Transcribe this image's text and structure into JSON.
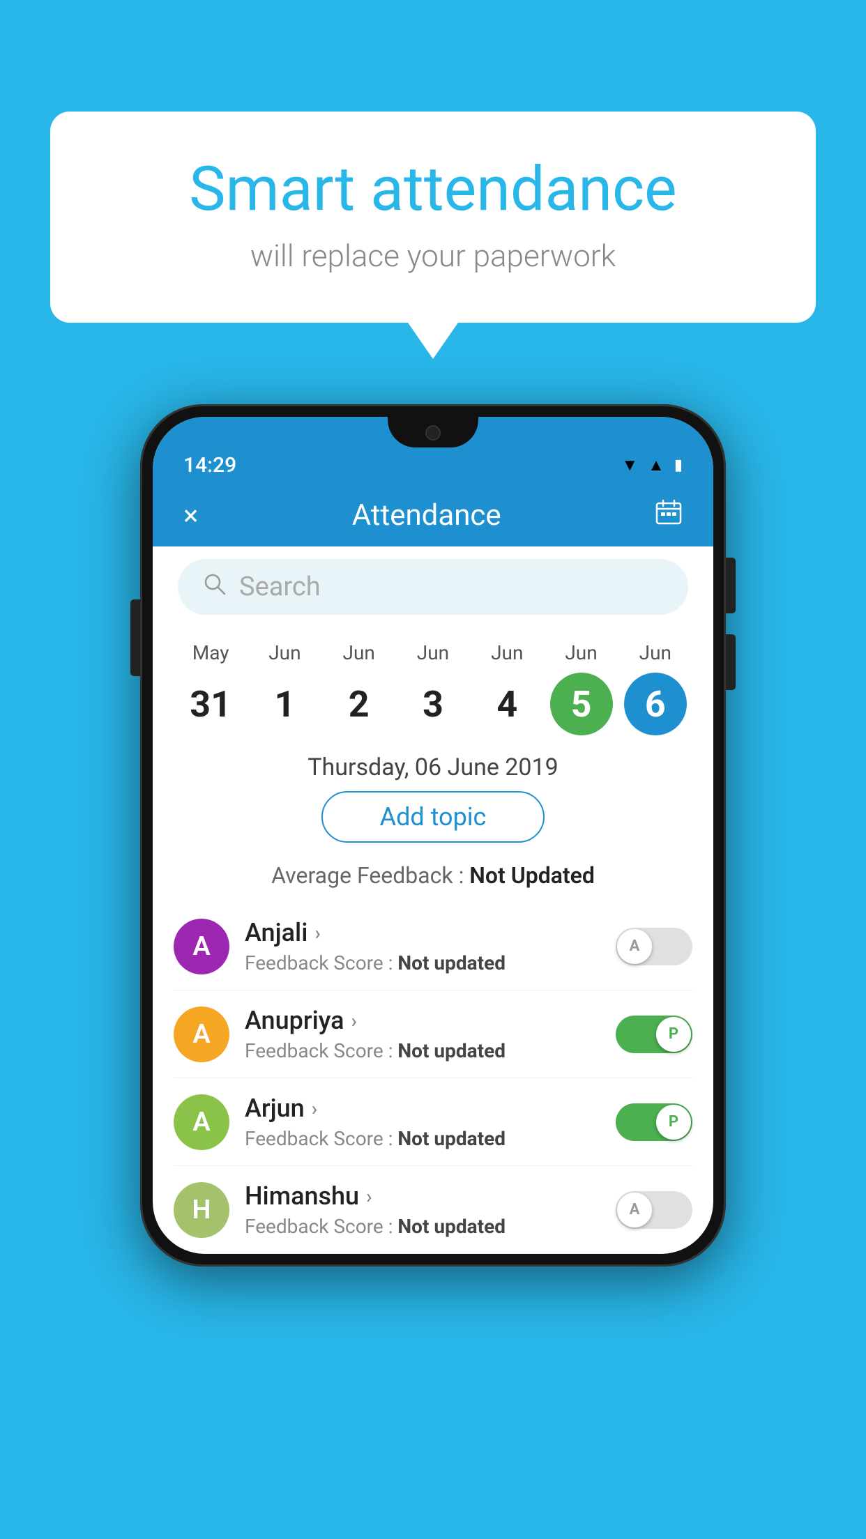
{
  "background_color": "#29b6e8",
  "speech_bubble": {
    "title": "Smart attendance",
    "subtitle": "will replace your paperwork"
  },
  "status_bar": {
    "time": "14:29",
    "icons": [
      "wifi",
      "signal",
      "battery"
    ]
  },
  "app_bar": {
    "title": "Attendance",
    "close_label": "×",
    "calendar_label": "📅"
  },
  "search": {
    "placeholder": "Search"
  },
  "calendar": {
    "days": [
      {
        "month": "May",
        "date": "31",
        "state": "normal"
      },
      {
        "month": "Jun",
        "date": "1",
        "state": "normal"
      },
      {
        "month": "Jun",
        "date": "2",
        "state": "normal"
      },
      {
        "month": "Jun",
        "date": "3",
        "state": "normal"
      },
      {
        "month": "Jun",
        "date": "4",
        "state": "normal"
      },
      {
        "month": "Jun",
        "date": "5",
        "state": "today"
      },
      {
        "month": "Jun",
        "date": "6",
        "state": "selected"
      }
    ]
  },
  "selected_date_label": "Thursday, 06 June 2019",
  "add_topic_label": "Add topic",
  "avg_feedback_prefix": "Average Feedback : ",
  "avg_feedback_value": "Not Updated",
  "students": [
    {
      "name": "Anjali",
      "avatar_letter": "A",
      "avatar_color": "#9c27b0",
      "feedback_prefix": "Feedback Score : ",
      "feedback_value": "Not updated",
      "toggle_state": "off",
      "toggle_label": "A"
    },
    {
      "name": "Anupriya",
      "avatar_letter": "A",
      "avatar_color": "#f5a623",
      "feedback_prefix": "Feedback Score : ",
      "feedback_value": "Not updated",
      "toggle_state": "on",
      "toggle_label": "P"
    },
    {
      "name": "Arjun",
      "avatar_letter": "A",
      "avatar_color": "#8bc34a",
      "feedback_prefix": "Feedback Score : ",
      "feedback_value": "Not updated",
      "toggle_state": "on",
      "toggle_label": "P"
    },
    {
      "name": "Himanshu",
      "avatar_letter": "H",
      "avatar_color": "#a5c16c",
      "feedback_prefix": "Feedback Score : ",
      "feedback_value": "Not updated",
      "toggle_state": "off",
      "toggle_label": "A"
    }
  ]
}
